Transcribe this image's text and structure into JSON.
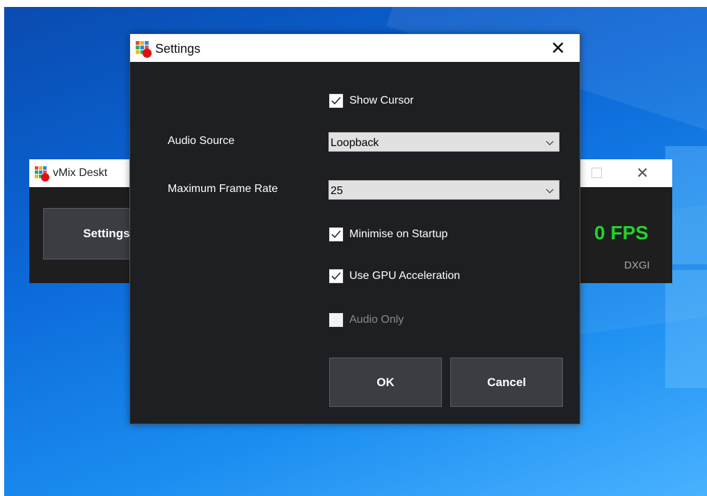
{
  "background_window": {
    "title": "vMix Deskt",
    "settings_label": "Settings",
    "fps_text": "0 FPS",
    "capture_mode": "DXGI"
  },
  "dialog": {
    "title": "Settings",
    "close_glyph": "✕",
    "show_cursor": {
      "label": "Show Cursor",
      "checked": true
    },
    "audio_source": {
      "label": "Audio Source",
      "value": "Loopback"
    },
    "max_frame_rate": {
      "label": "Maximum Frame Rate",
      "value": "25"
    },
    "minimise_on_startup": {
      "label": "Minimise on Startup",
      "checked": true
    },
    "use_gpu_acceleration": {
      "label": "Use GPU Acceleration",
      "checked": true
    },
    "audio_only": {
      "label": "Audio Only",
      "checked": false,
      "disabled": true
    },
    "ok_label": "OK",
    "cancel_label": "Cancel"
  },
  "colors": {
    "dialog_bg": "#1e1f22",
    "button_bg": "#3b3d42",
    "fps_green": "#22d32a"
  },
  "icons": [
    "vmix-app-icon",
    "close-icon",
    "checkmark-icon",
    "chevron-down-icon",
    "maximize-icon"
  ]
}
